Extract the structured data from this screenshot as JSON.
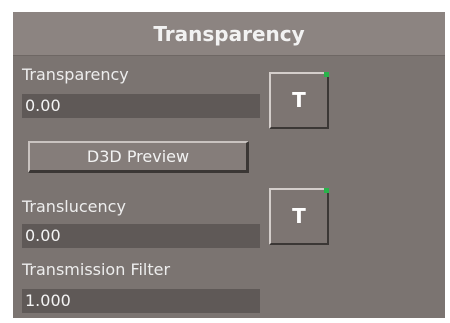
{
  "panel": {
    "title": "Transparency"
  },
  "transparency": {
    "label": "Transparency",
    "value": "0.00",
    "button_label": "T"
  },
  "preview": {
    "label": "D3D Preview"
  },
  "translucency": {
    "label": "Translucency",
    "value": "0.00",
    "button_label": "T"
  },
  "transmission_filter": {
    "label": "Transmission Filter",
    "value": "1.000"
  },
  "colors": {
    "panel_bg": "#7b7471",
    "header_bg": "#8c8481",
    "field_bg": "#5f5957",
    "indicator": "#27b34a"
  }
}
